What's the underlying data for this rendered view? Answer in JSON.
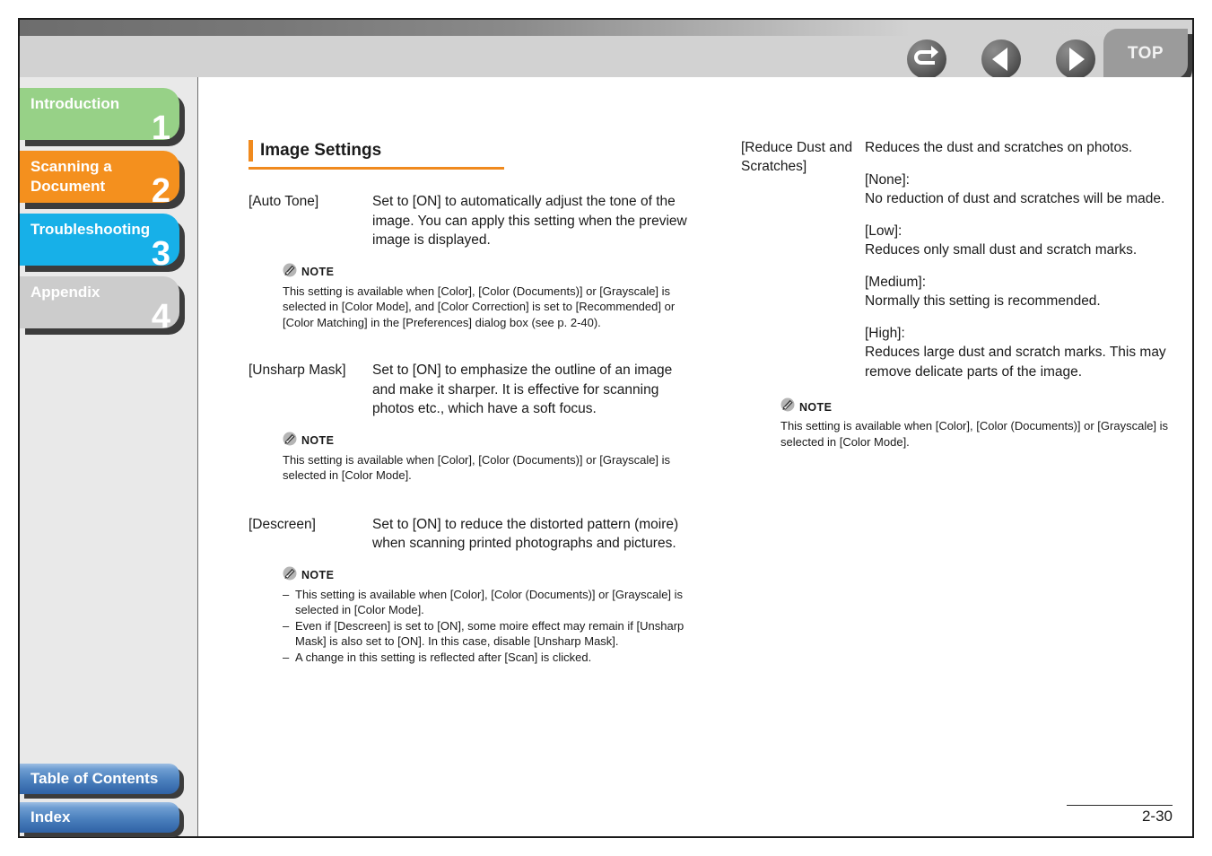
{
  "header": {
    "nav_buttons": [
      {
        "label": "Back",
        "icon": "back-arrow-icon"
      },
      {
        "label": "Previous",
        "icon": "left-triangle-icon"
      },
      {
        "label": "Next",
        "icon": "right-triangle-icon"
      }
    ],
    "top_button": {
      "label": "TOP"
    }
  },
  "sidebar": {
    "tabs": [
      {
        "label": "Introduction",
        "number": "1",
        "color": "#97d187"
      },
      {
        "label": "Scanning a\nDocument",
        "number": "2",
        "color": "#f4901e"
      },
      {
        "label": "Troubleshooting",
        "number": "3",
        "color": "#17b0e8"
      },
      {
        "label": "Appendix",
        "number": "4",
        "color": "#cccccc"
      }
    ],
    "links": [
      {
        "label": "Table of Contents"
      },
      {
        "label": "Index"
      }
    ]
  },
  "main": {
    "heading": "Image Settings",
    "left_column": [
      {
        "term": "[Auto Tone]",
        "paragraphs": [
          "Set to [ON] to automatically adjust the tone of the image. You can apply this setting when the preview image is displayed."
        ],
        "note": {
          "title": "NOTE",
          "icon": "note-pencil-icon",
          "paragraphs": [
            "This setting is available when [Color], [Color (Documents)] or [Grayscale] is selected in [Color Mode], and [Color Correction] is set to [Recommended] or [Color Matching] in the [Preferences] dialog box (see p. 2-40)."
          ],
          "items": []
        }
      },
      {
        "term": "[Unsharp Mask]",
        "paragraphs": [
          "Set to [ON] to emphasize the outline of an image and make it sharper. It is effective for scanning photos etc., which have a soft focus."
        ],
        "note": {
          "title": "NOTE",
          "icon": "note-pencil-icon",
          "paragraphs": [
            "This setting is available when [Color], [Color (Documents)] or [Grayscale] is selected in [Color Mode]."
          ],
          "items": []
        }
      },
      {
        "term": "[Descreen]",
        "paragraphs": [
          "Set to [ON] to reduce the distorted pattern (moire) when scanning printed photographs and pictures."
        ],
        "note": {
          "title": "NOTE",
          "icon": "note-pencil-icon",
          "paragraphs": [],
          "items": [
            "This setting is available when [Color], [Color (Documents)] or [Grayscale] is selected in [Color Mode].",
            "Even if [Descreen] is set to [ON], some moire effect may remain if [Unsharp Mask] is also set to [ON]. In this case, disable [Unsharp Mask].",
            "A change in this setting is reflected after [Scan] is clicked."
          ]
        }
      }
    ],
    "right_column": [
      {
        "term": "[Reduce Dust and Scratches]",
        "paragraphs": [
          "Reduces the dust and scratches on photos.",
          "[None]:\nNo reduction of dust and scratches will be made.",
          "[Low]:\nReduces only small dust and scratch marks.",
          "[Medium]:\nNormally this setting is recommended.",
          "[High]:\nReduces large dust and scratch marks. This may remove delicate parts of the image."
        ],
        "note": {
          "title": "NOTE",
          "icon": "note-pencil-icon",
          "paragraphs": [
            "This setting is available when [Color], [Color (Documents)] or [Grayscale] is selected in [Color Mode]."
          ],
          "items": []
        }
      }
    ]
  },
  "footer": {
    "page_number": "2-30"
  }
}
